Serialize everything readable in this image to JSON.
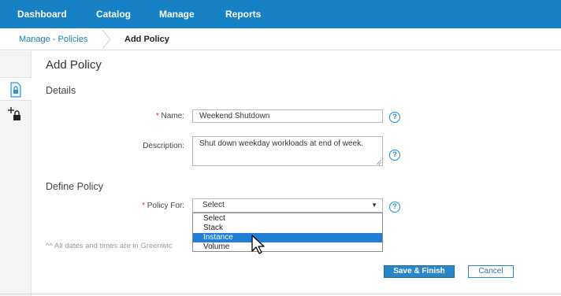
{
  "nav": {
    "items": [
      {
        "label": "Dashboard"
      },
      {
        "label": "Catalog"
      },
      {
        "label": "Manage"
      },
      {
        "label": "Reports"
      }
    ]
  },
  "breadcrumb": {
    "parent": "Manage - Policies",
    "current": "Add Policy"
  },
  "page": {
    "title": "Add Policy"
  },
  "details": {
    "section_title": "Details",
    "name": {
      "required_mark": "*",
      "label": "Name:",
      "value": "Weekend Shutdown"
    },
    "description": {
      "label": "Description:",
      "value": "Shut down weekday workloads at end of week."
    }
  },
  "define_policy": {
    "section_title": "Define Policy",
    "policy_for": {
      "required_mark": "*",
      "label": "Policy For:",
      "selected": "Select",
      "options": [
        "Select",
        "Stack",
        "Instance",
        "Volume"
      ],
      "highlighted_index": 2
    }
  },
  "footnote": "^^ All dates and times are in Greenwic",
  "actions": {
    "save_label": "Save & Finish",
    "cancel_label": "Cancel"
  },
  "help_glyph": "?",
  "colors": {
    "nav_bg": "#1681c4",
    "accent": "#1e7fd4",
    "required": "#d33333",
    "link": "#1a7db5"
  },
  "icons": {
    "rail_top": "locked-document-icon",
    "rail_bottom": "add-lock-icon",
    "help": "help-circle-icon",
    "cursor": "pointer-cursor-icon"
  }
}
